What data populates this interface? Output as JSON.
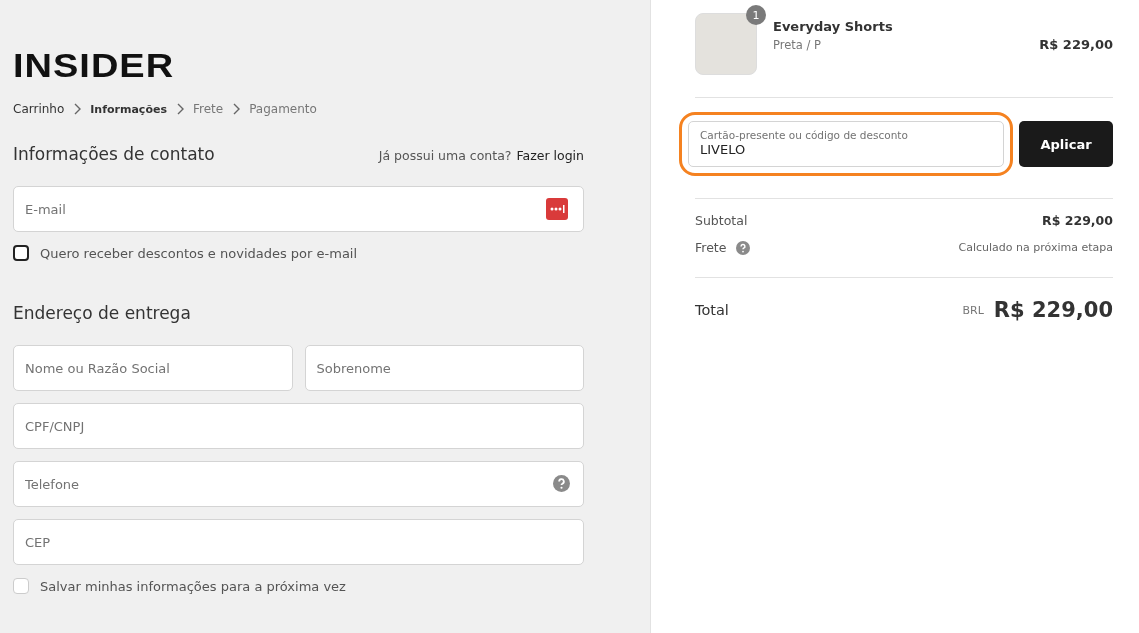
{
  "logo": "INSIDER",
  "breadcrumb": [
    {
      "label": "Carrinho",
      "selected": false,
      "done": true
    },
    {
      "label": "Informações",
      "selected": true,
      "done": false
    },
    {
      "label": "Frete",
      "selected": false,
      "done": false
    },
    {
      "label": "Pagamento",
      "selected": false,
      "done": false
    }
  ],
  "contact": {
    "title": "Informações de contato",
    "prompt": "Já possui uma conta?",
    "login_link": "Fazer login",
    "email": {
      "placeholder": "E-mail",
      "kind": "password-manager"
    },
    "newsletter": {
      "label": "Quero receber descontos e novidades por e-mail",
      "checked": false,
      "kind": "dark-border"
    }
  },
  "shipping": {
    "title": "Endereço de entrega",
    "rows": [
      [
        {
          "placeholder": "Nome ou Razão Social",
          "kind": "plain"
        },
        {
          "placeholder": "Sobrenome",
          "kind": "plain"
        }
      ],
      [
        {
          "placeholder": "CPF/CNPJ",
          "kind": "plain"
        }
      ],
      [
        {
          "placeholder": "Telefone",
          "kind": "help"
        }
      ],
      [
        {
          "placeholder": "CEP",
          "kind": "plain"
        }
      ]
    ],
    "save_info": {
      "label": "Salvar minhas informações para a próxima vez",
      "checked": false,
      "kind": "light-border"
    }
  },
  "cart": {
    "items": [
      {
        "quantity": "1",
        "name": "Everyday Shorts",
        "variant": "Preta / P",
        "price": "R$ 229,00"
      }
    ],
    "discount": {
      "label": "Cartão-presente ou código de desconto",
      "value": "LIVELO",
      "highlighted": true,
      "button": "Aplicar"
    },
    "subtotal": {
      "label": "Subtotal",
      "value": "R$ 229,00"
    },
    "shipping": {
      "label": "Frete",
      "value": "Calculado na próxima etapa"
    },
    "total": {
      "label": "Total",
      "currency": "BRL",
      "value": "R$ 229,00"
    }
  }
}
